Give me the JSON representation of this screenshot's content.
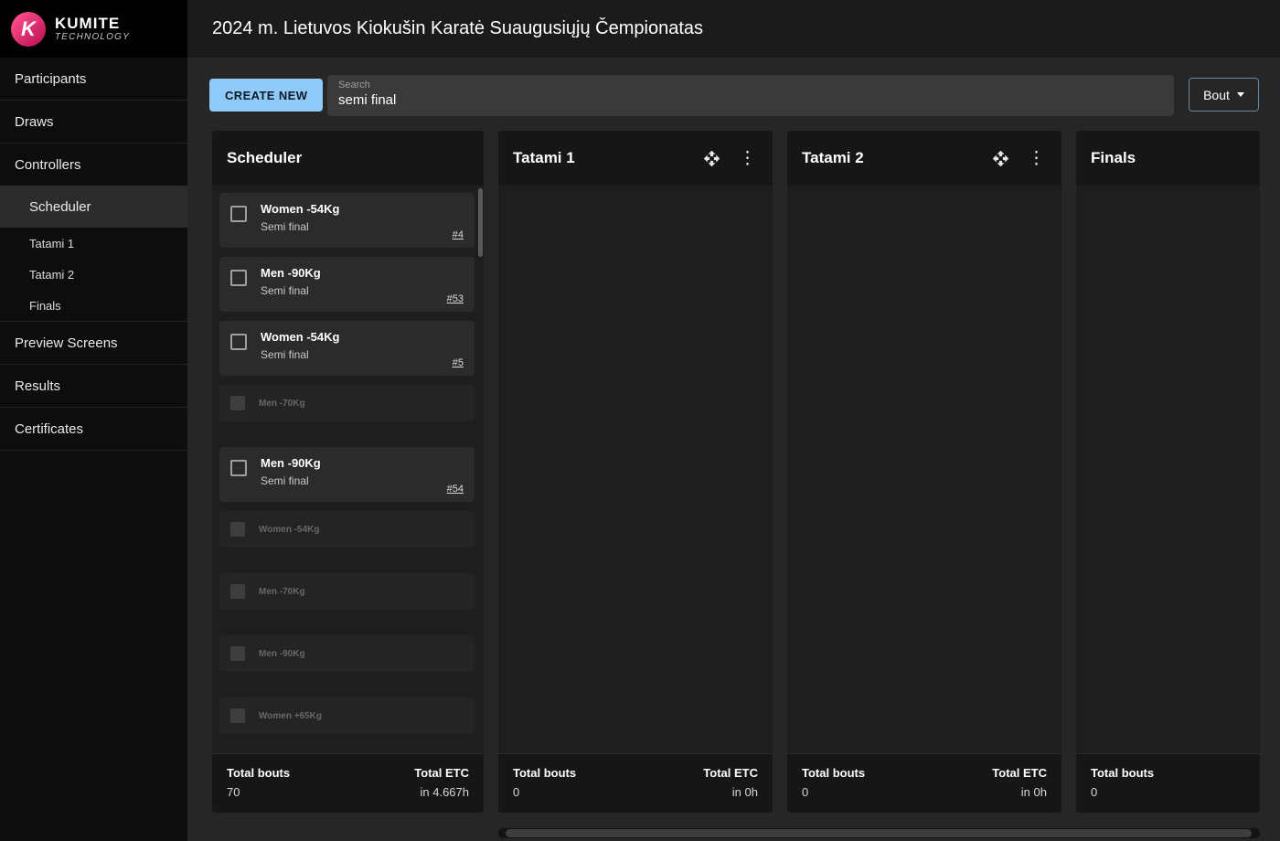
{
  "brand": {
    "letter": "K",
    "name": "KUMITE",
    "tagline": "TECHNOLOGY"
  },
  "header": {
    "title": "2024 m. Lietuvos Kiokušin Karatė Suaugusiųjų Čempionatas"
  },
  "sidebar": {
    "items": [
      {
        "label": "Participants"
      },
      {
        "label": "Draws"
      },
      {
        "label": "Controllers"
      },
      {
        "label": "Scheduler"
      },
      {
        "label": "Tatami 1"
      },
      {
        "label": "Tatami 2"
      },
      {
        "label": "Finals"
      },
      {
        "label": "Preview Screens"
      },
      {
        "label": "Results"
      },
      {
        "label": "Certificates"
      }
    ]
  },
  "toolbar": {
    "create_label": "CREATE NEW",
    "search_label": "Search",
    "search_value": "semi final",
    "bout_label": "Bout"
  },
  "icons": {
    "kebab": "⋮"
  },
  "panels": {
    "scheduler": {
      "title": "Scheduler",
      "bouts": [
        {
          "title": "Women -54Kg",
          "subtitle": "Semi final",
          "number": "#4"
        },
        {
          "title": "Men -90Kg",
          "subtitle": "Semi final",
          "number": "#53"
        },
        {
          "title": "Women -54Kg",
          "subtitle": "Semi final",
          "number": "#5"
        },
        {
          "title": "Men -70Kg"
        },
        {
          "title": "Men -90Kg",
          "subtitle": "Semi final",
          "number": "#54"
        },
        {
          "title": "Women -54Kg"
        },
        {
          "title": "Men -70Kg"
        },
        {
          "title": "Men -90Kg"
        },
        {
          "title": "Women +65Kg"
        }
      ],
      "footer": {
        "bouts_label": "Total bouts",
        "bouts_value": "70",
        "etc_label": "Total ETC",
        "etc_value": "in 4.667h"
      }
    },
    "tatami1": {
      "title": "Tatami 1",
      "footer": {
        "bouts_label": "Total bouts",
        "bouts_value": "0",
        "etc_label": "Total ETC",
        "etc_value": "in 0h"
      }
    },
    "tatami2": {
      "title": "Tatami 2",
      "footer": {
        "bouts_label": "Total bouts",
        "bouts_value": "0",
        "etc_label": "Total ETC",
        "etc_value": "in 0h"
      }
    },
    "finals": {
      "title": "Finals",
      "footer": {
        "bouts_label": "Total bouts",
        "bouts_value": "0"
      }
    }
  }
}
